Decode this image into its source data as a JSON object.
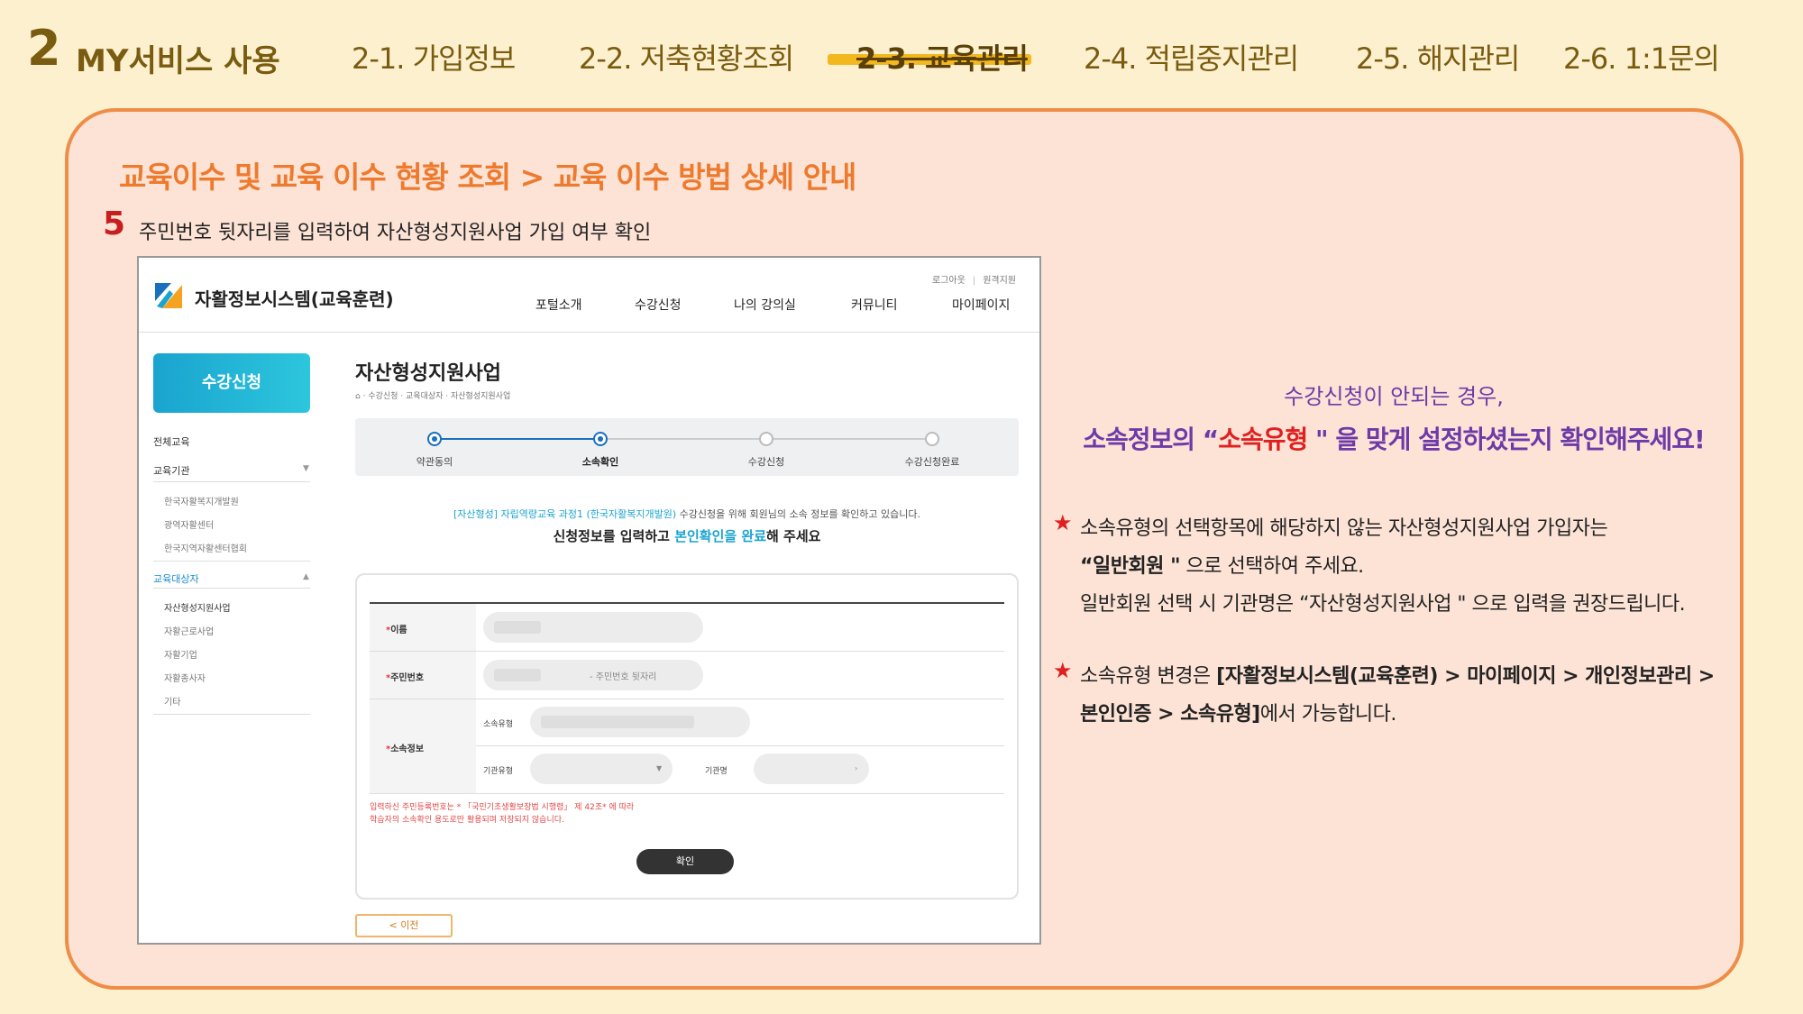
{
  "header": {
    "section_number": "2",
    "section_title": "MY서비스 사용",
    "tabs": [
      {
        "label": "2-1. 가입정보"
      },
      {
        "label": "2-2. 저축현황조회"
      },
      {
        "label": "2-3. 교육관리"
      },
      {
        "label": "2-4. 적립중지관리"
      },
      {
        "label": "2-5. 해지관리"
      },
      {
        "label": "2-6. 1:1문의"
      }
    ]
  },
  "panel": {
    "heading": "교육이수 및 교육 이수 현황 조회 > 교육 이수 방법 상세 안내",
    "step_number": "5",
    "step_text": "주민번호 뒷자리를 입력하여 자산형성지원사업 가입 여부 확인"
  },
  "site": {
    "name": "자활정보시스템(교육훈련)",
    "util_links": [
      "로그아웃",
      "원격지원"
    ],
    "nav": [
      "포털소개",
      "수강신청",
      "나의 강의실",
      "커뮤니티",
      "마이페이지"
    ],
    "sidebar": {
      "button": "수강신청",
      "items": [
        {
          "label": "전체교육"
        },
        {
          "label": "교육기관",
          "caret": "▼"
        },
        {
          "label": "한국자활복지개발원"
        },
        {
          "label": "광역자활센터"
        },
        {
          "label": "한국지역자활센터협회"
        },
        {
          "label": "교육대상자",
          "caret": "▲"
        },
        {
          "label": "자산형성지원사업"
        },
        {
          "label": "자활근로사업"
        },
        {
          "label": "자활기업"
        },
        {
          "label": "자활종사자"
        },
        {
          "label": "기타"
        }
      ]
    },
    "content": {
      "title": "자산형성지원사업",
      "breadcrumb": "· 수강신청 · 교육대상자 · 자산형성지원사업",
      "steps": [
        "약관동의",
        "소속확인",
        "수강신청",
        "수강신청완료"
      ],
      "notice_prefix": "[자산형성] 자립역량교육 과정1 (한국자활복지개발원)",
      "notice_suffix": " 수강신청을 위해 회원님의 소속 정보를 확인하고 있습니다.",
      "notice2_a": "신청정보를 입력하고 ",
      "notice2_hl": "본인확인을 완료",
      "notice2_b": "해 주세요",
      "form": {
        "name_label": "이름",
        "rrn_label": "주민번호",
        "rrn_placeholder": "- 주민번호 뒷자리",
        "affil_label": "소속정보",
        "affil_type_label": "소속유형",
        "org_type_label": "기관유형",
        "org_name_label": "기관명",
        "required_mark": "*",
        "legal_line1": "입력하신 주민등록번호는 * 「국민기초생활보장법 시행령」 제 42조* 에 따라",
        "legal_line2": "학습자의 소속확인 용도로만 활용되며 저장되지 않습니다.",
        "confirm_button": "확인",
        "prev_button": "<    이전"
      }
    }
  },
  "explanation": {
    "line1": "수강신청이 안되는 경우,",
    "line2_a": "소속정보의 “",
    "line2_red": "소속유형",
    "line2_b": " \" 을 맞게 설정하셨는지 확인해주세요!",
    "star": "★",
    "bullet1_l1": "소속유형의 선택항목에 해당하지 않는 자산형성지원사업 가입자는",
    "bullet1_l2_bold": "“일반회원 \"",
    "bullet1_l2_rest": " 으로 선택하여 주세요.",
    "bullet1_l3": "일반회원 선택 시 기관명은 “자산형성지원사업 \" 으로 입력을 권장드립니다.",
    "bullet2_l1_a": "소속유형 변경은 ",
    "bullet2_l1_bold": "[자활정보시스템(교육훈련) > 마이페이지 > 개인정보관리 >",
    "bullet2_l2_bold": "본인인증 > 소속유형]",
    "bullet2_l2_rest": "에서 가능합니다."
  },
  "colors": {
    "background": "#fdf0cf",
    "panel_fill": "#fce3d6",
    "panel_border": "#ee8d47",
    "heading_orange": "#ee7a2e",
    "accent_purple": "#6e3aa8",
    "accent_red": "#e02020",
    "site_cyan": "#1aa4cf",
    "active_tab_bar": "#f4b81f"
  }
}
